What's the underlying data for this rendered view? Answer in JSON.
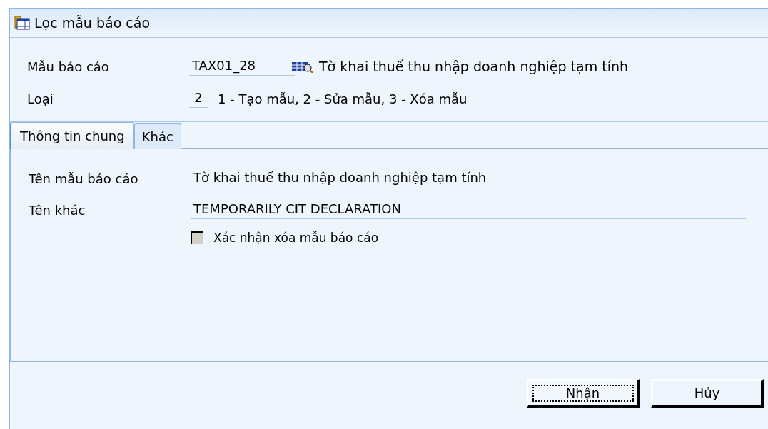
{
  "window": {
    "title": "Lọc mẫu báo cáo"
  },
  "header_fields": [
    {
      "label": "Mẫu báo cáo",
      "value": "TAX01_28",
      "kind": "lookup",
      "description": "Tờ khai thuế thu nhập doanh nghiệp tạm tính"
    },
    {
      "label": "Loại",
      "value": "2",
      "kind": "code",
      "description": "1 - Tạo mẫu, 2 - Sửa mẫu, 3 - Xóa mẫu"
    }
  ],
  "tabs": [
    {
      "label": "Thông tin chung",
      "selected": true
    },
    {
      "label": "Khác",
      "selected": false
    }
  ],
  "fields": [
    {
      "label": "Tên mẫu báo cáo",
      "value": "Tờ khai thuế thu nhập doanh nghiệp tạm tính",
      "underlined": false
    },
    {
      "label": "Tên khác",
      "value": "TEMPORARILY CIT DECLARATION",
      "underlined": true
    }
  ],
  "confirm_checkbox": {
    "label": "Xác nhận xóa mẫu báo cáo",
    "checked": false
  },
  "buttons": [
    {
      "label": "Nhận",
      "focused": true
    },
    {
      "label": "Hủy",
      "focused": false
    }
  ]
}
